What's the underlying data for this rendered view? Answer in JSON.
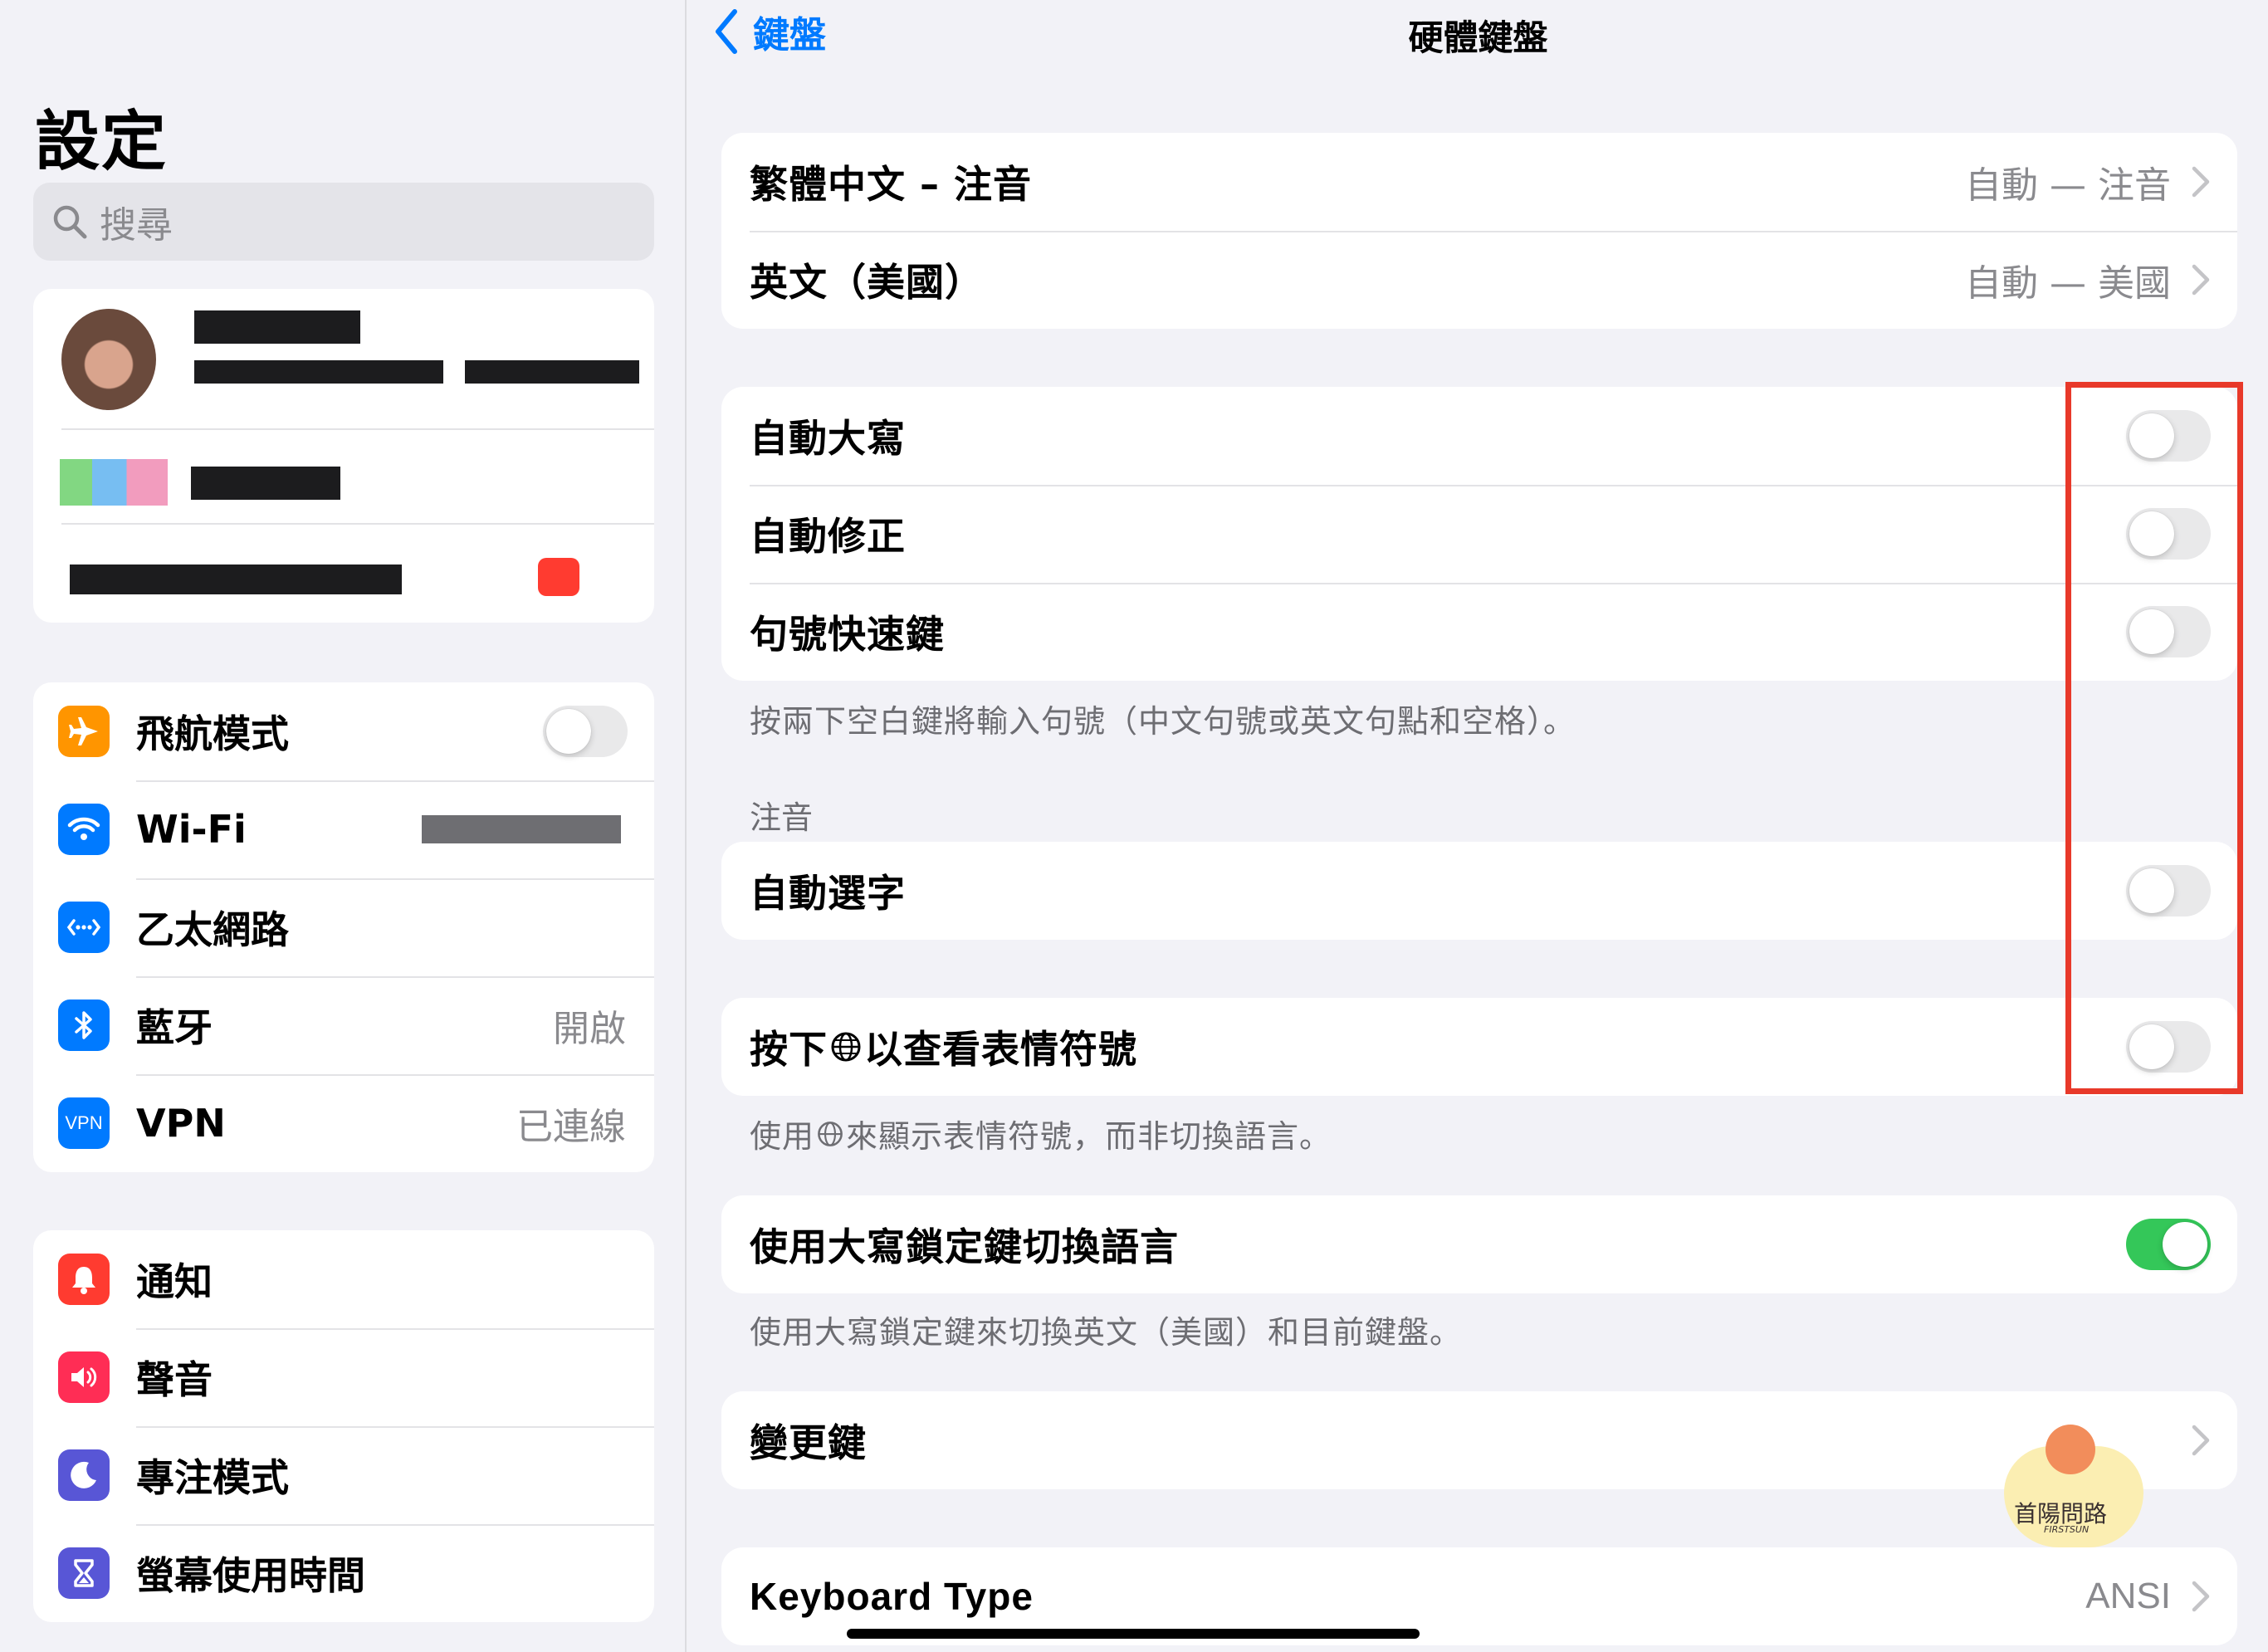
{
  "sidebar": {
    "title": "設定",
    "search_placeholder": "搜尋",
    "group1": [
      {
        "label": "飛航模式",
        "icon": "airplane-icon",
        "color": "#ff9500",
        "toggle": false
      },
      {
        "label": "Wi-Fi",
        "icon": "wifi-icon",
        "color": "#007aff"
      },
      {
        "label": "乙太網路",
        "icon": "ethernet-icon",
        "color": "#007aff"
      },
      {
        "label": "藍牙",
        "icon": "bluetooth-icon",
        "color": "#007aff",
        "value": "開啟"
      },
      {
        "label": "VPN",
        "icon": "vpn-icon",
        "color": "#007aff",
        "value": "已連線",
        "icon_text": "VPN"
      }
    ],
    "group2": [
      {
        "label": "通知",
        "icon": "bell-icon",
        "color": "#ff3b30"
      },
      {
        "label": "聲音",
        "icon": "speaker-icon",
        "color": "#ff2d55"
      },
      {
        "label": "專注模式",
        "icon": "moon-icon",
        "color": "#5856d6"
      },
      {
        "label": "螢幕使用時間",
        "icon": "hourglass-icon",
        "color": "#5856d6"
      }
    ]
  },
  "nav": {
    "back_label": "鍵盤",
    "title": "硬體鍵盤"
  },
  "keyboards": [
    {
      "label": "繁體中文 – 注音",
      "value": "自動 — 注音"
    },
    {
      "label": "英文（美國）",
      "value": "自動 — 美國"
    }
  ],
  "toggles_group": [
    {
      "label": "自動大寫",
      "on": false
    },
    {
      "label": "自動修正",
      "on": false
    },
    {
      "label": "句號快速鍵",
      "on": false
    }
  ],
  "period_footnote": "按兩下空白鍵將輸入句號（中文句號或英文句點和空格）。",
  "zhuyin_header": "注音",
  "auto_select": {
    "label": "自動選字",
    "on": false
  },
  "globe_emoji": {
    "label_prefix": "按下",
    "label_suffix": "以查看表情符號",
    "on": false
  },
  "globe_footnote_prefix": "使用",
  "globe_footnote_suffix": "來顯示表情符號，而非切換語言。",
  "caps_lock": {
    "label": "使用大寫鎖定鍵切換語言",
    "on": true
  },
  "caps_footnote": "使用大寫鎖定鍵來切換英文（美國）和目前鍵盤。",
  "modifier_keys": {
    "label": "變更鍵"
  },
  "keyboard_type": {
    "label": "Keyboard Type",
    "value": "ANSI"
  },
  "watermark": {
    "text": "首陽問路",
    "sub": "FIRSTSUN"
  },
  "colors": {
    "accent": "#007aff",
    "toggle_on": "#34c759",
    "highlight": "#e8392a"
  }
}
